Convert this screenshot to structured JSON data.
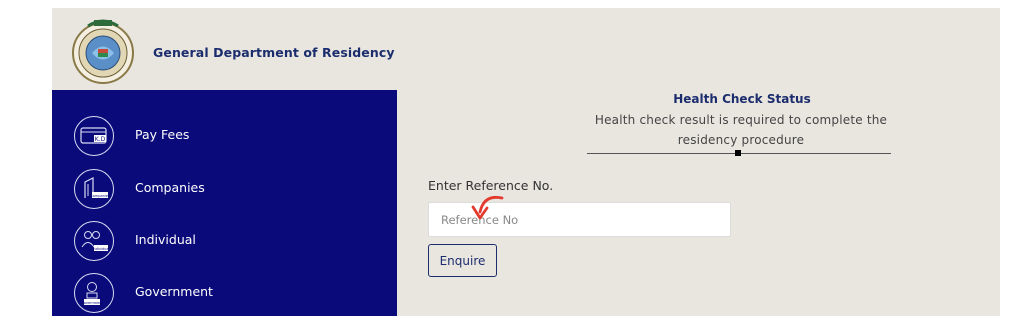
{
  "header": {
    "org_title": "General Department of Residency"
  },
  "sidebar": {
    "items": [
      {
        "label": "Pay Fees",
        "icon": "card-kd-icon",
        "icon_text": "K.D"
      },
      {
        "label": "Companies",
        "icon": "building-icon",
        "icon_text": "Companies"
      },
      {
        "label": "Individual",
        "icon": "people-icon",
        "icon_text": "Individual"
      },
      {
        "label": "Government",
        "icon": "government-icon",
        "icon_text": "Government"
      }
    ]
  },
  "main": {
    "status_title": "Health Check Status",
    "status_description": "Health check result is required to complete the residency procedure",
    "reference_label": "Enter Reference No.",
    "reference_placeholder": "Reference No",
    "enquire_label": "Enquire"
  },
  "colors": {
    "sidebar_bg": "#0a0a7a",
    "page_bg": "#e9e6e0",
    "accent_text": "#1c2d6e",
    "annotation_arrow": "#e23b2e"
  }
}
